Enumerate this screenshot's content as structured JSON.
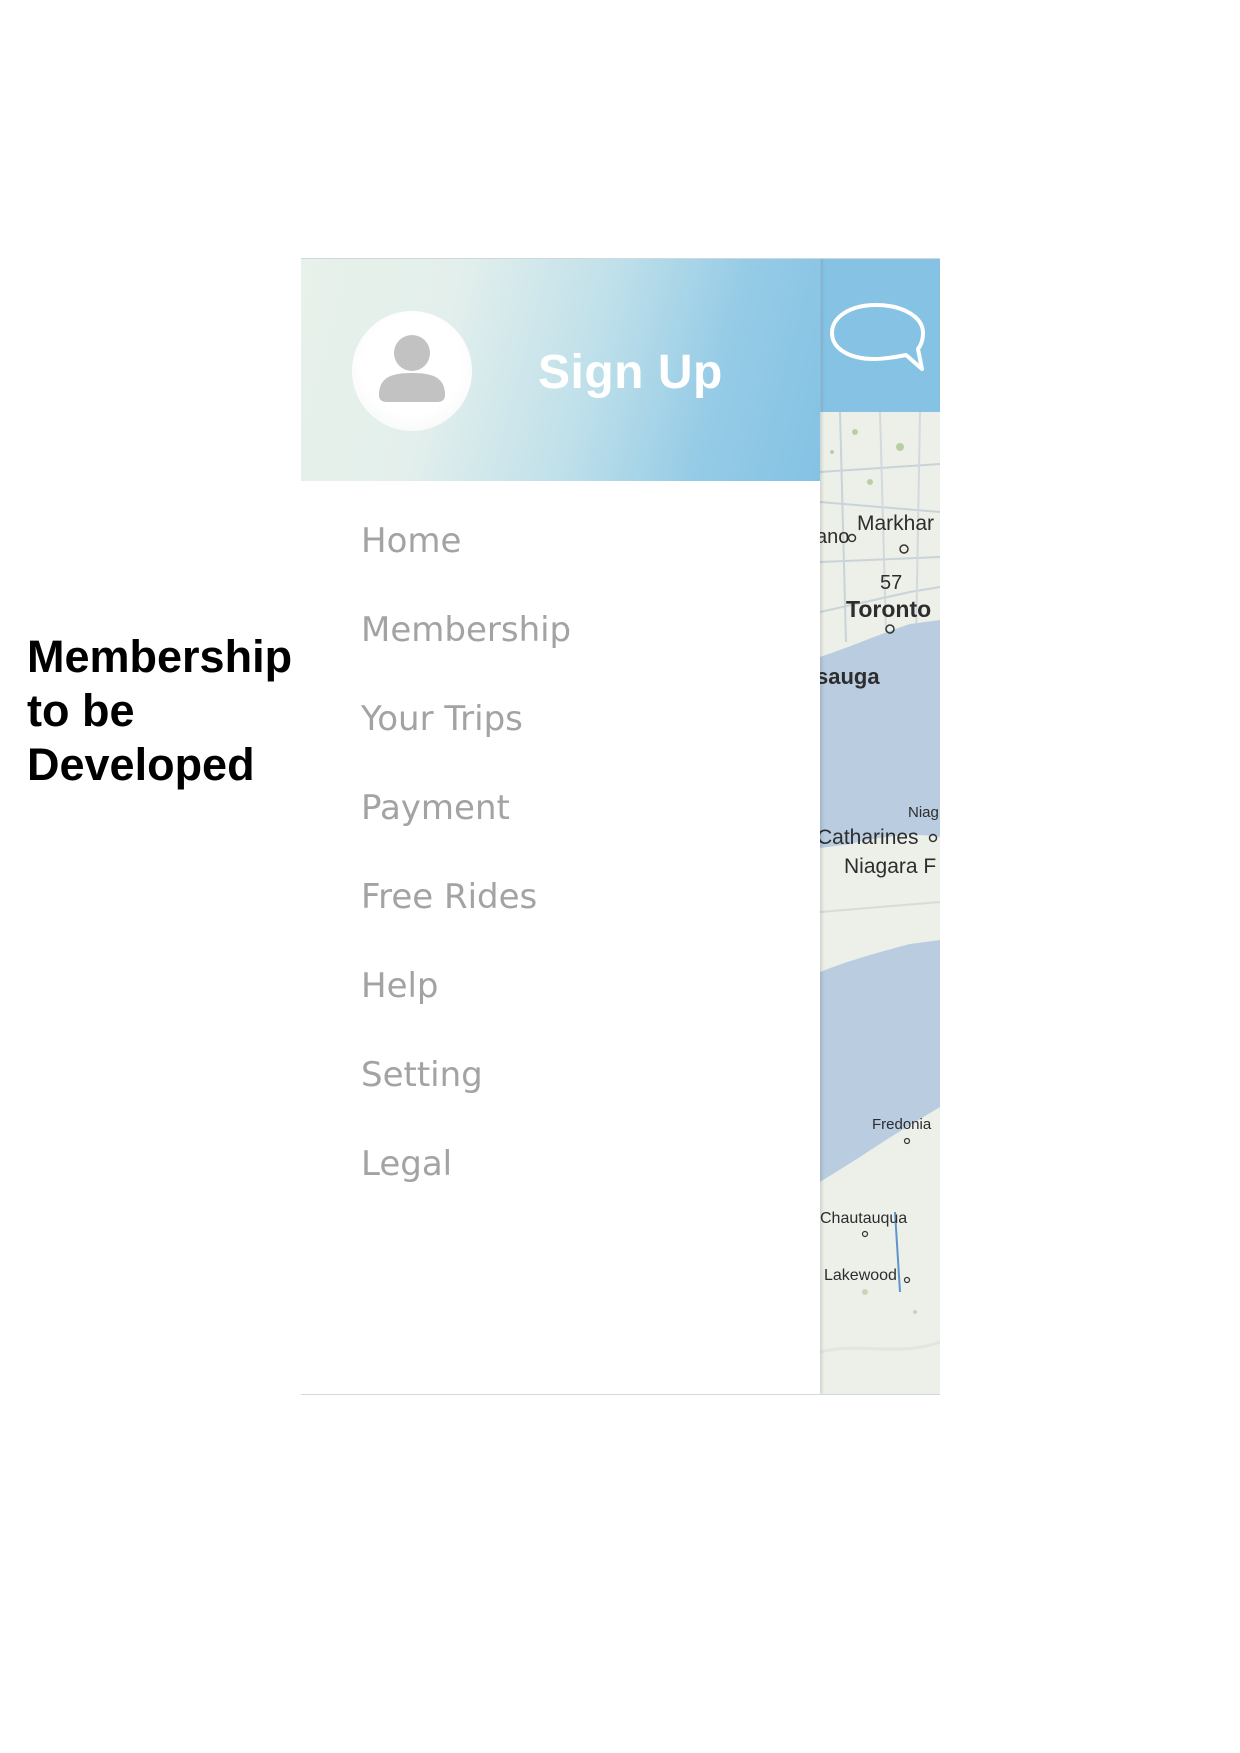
{
  "annotation": {
    "lines": [
      "Membership",
      "to be",
      "Developed"
    ]
  },
  "drawer": {
    "header": {
      "signup_label": "Sign Up",
      "avatar_icon": "user-icon"
    },
    "menu": [
      {
        "label": "Home"
      },
      {
        "label": "Membership"
      },
      {
        "label": "Your Trips"
      },
      {
        "label": "Payment"
      },
      {
        "label": "Free Rides"
      },
      {
        "label": "Help"
      },
      {
        "label": "Setting"
      },
      {
        "label": "Legal"
      }
    ]
  },
  "topbar": {
    "chat_icon": "chat-bubble-icon"
  },
  "map": {
    "labels": [
      "Markhar",
      "ano",
      "57",
      "Toronto",
      "sauga",
      "Niag",
      "Catharines",
      "Niagara F",
      "Fredonia",
      "Chautauqua",
      "Lakewood"
    ]
  },
  "colors": {
    "header_gradient_start": "#e8f1ea",
    "header_gradient_end": "#84c2e4",
    "topbar_blue": "#86c2e3",
    "menu_text": "#a3a3a3",
    "lake": "#b9cce0",
    "land": "#edefe9"
  }
}
